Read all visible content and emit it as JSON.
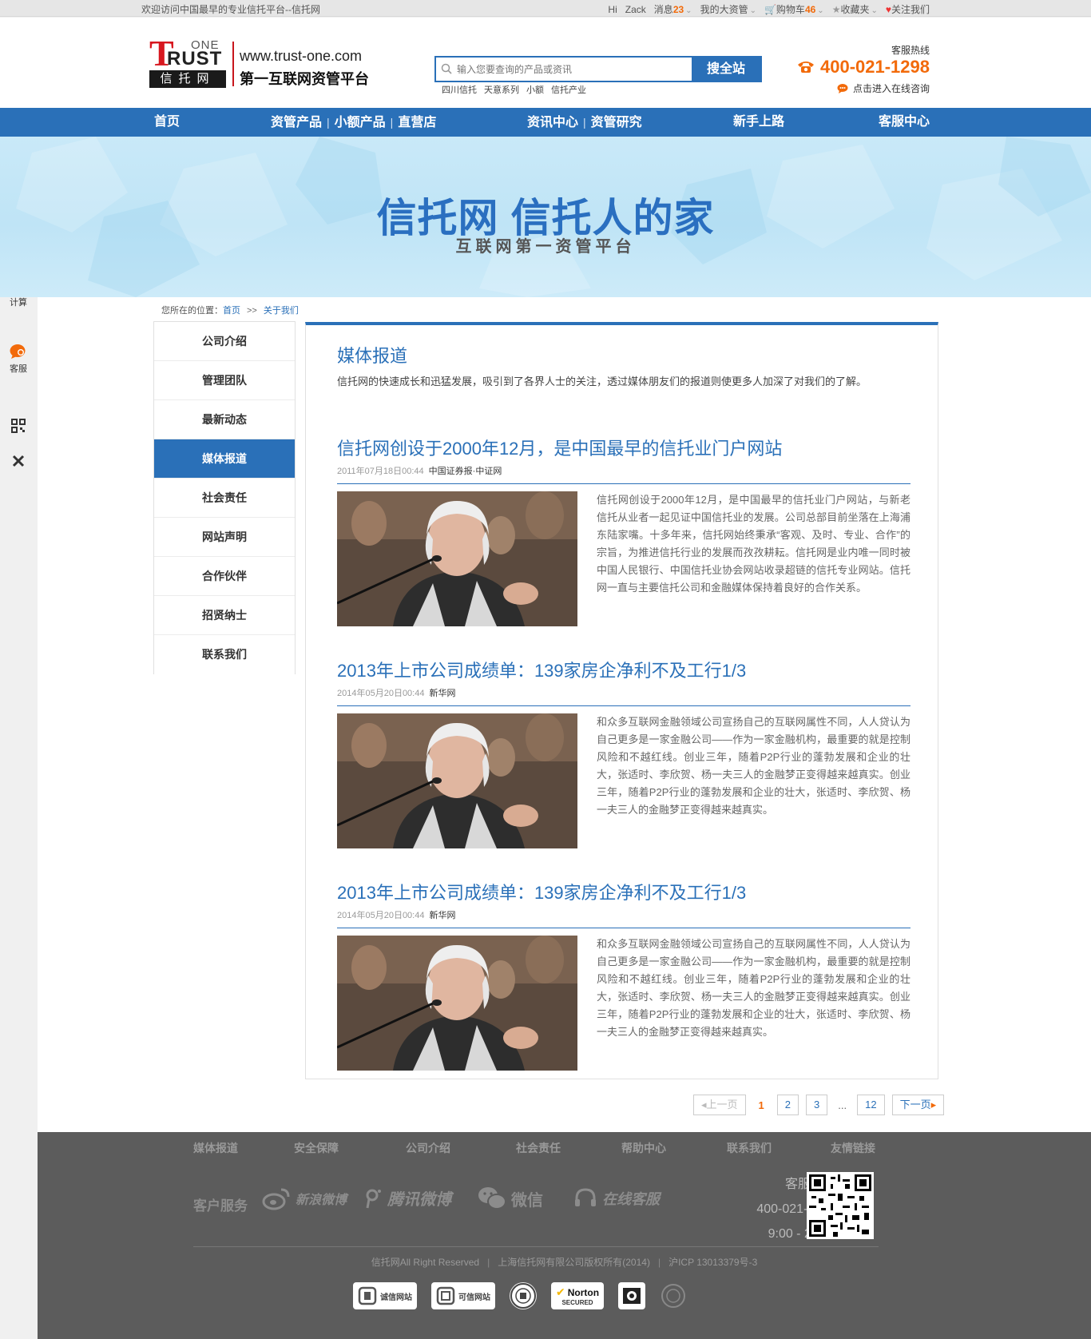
{
  "topbar": {
    "welcome": "欢迎访问中国最早的专业信托平台--信托网",
    "hi": "Hi",
    "user": "Zack",
    "messages_label": "消息",
    "messages_count": "23",
    "my_assets": "我的大资管",
    "cart_label": "购物车",
    "cart_count": "46",
    "favorites": "收藏夹",
    "follow": "关注我们"
  },
  "header": {
    "logo_one": "ONE",
    "logo_rust": "RUST",
    "logo_t": "T",
    "logo_cn": "信托网",
    "site_url": "www.trust-one.com",
    "slogan": "第一互联网资管平台",
    "search_placeholder": "输入您要查询的产品或资讯",
    "search_button": "搜全站",
    "hot_keywords": [
      "四川信托",
      "天意系列",
      "小额",
      "信托产业"
    ],
    "hotline_label": "客服热线",
    "hotline": "400-021-1298",
    "consult": "点击进入在线咨询"
  },
  "nav": {
    "home": "首页",
    "products": "资管产品",
    "small": "小额产品",
    "store": "直营店",
    "news": "资讯中心",
    "research": "资管研究",
    "newbie": "新手上路",
    "service": "客服中心",
    "sep": "|"
  },
  "banner": {
    "title": "信托网 信托人的家",
    "subtitle": "互联网第一资管平台"
  },
  "side_tools": {
    "calc": "计算",
    "service": "客服"
  },
  "breadcrumb": {
    "prefix": "您所在的位置：",
    "home": "首页",
    "sep": ">>",
    "current": "关于我们"
  },
  "menu": [
    {
      "label": "公司介绍",
      "active": false
    },
    {
      "label": "管理团队",
      "active": false
    },
    {
      "label": "最新动态",
      "active": false
    },
    {
      "label": "媒体报道",
      "active": true
    },
    {
      "label": "社会责任",
      "active": false
    },
    {
      "label": "网站声明",
      "active": false
    },
    {
      "label": "合作伙伴",
      "active": false
    },
    {
      "label": "招贤纳士",
      "active": false
    },
    {
      "label": "联系我们",
      "active": false
    }
  ],
  "content": {
    "heading": "媒体报道",
    "intro": "信托网的快速成长和迅猛发展，吸引到了各界人士的关注，透过媒体朋友们的报道则使更多人加深了对我们的了解。",
    "articles": [
      {
        "title": "信托网创设于2000年12月，是中国最早的信托业门户网站",
        "date": "2011年07月18日00:44",
        "source": "中国证券报·中证网",
        "text": "信托网创设于2000年12月，是中国最早的信托业门户网站，与新老信托从业者一起见证中国信托业的发展。公司总部目前坐落在上海浦东陆家嘴。十多年来，信托网始终秉承“客观、及时、专业、合作”的宗旨，为推进信托行业的发展而孜孜耕耘。信托网是业内唯一同时被中国人民银行、中国信托业协会网站收录超链的信托专业网站。信托网一直与主要信托公司和金融媒体保持着良好的合作关系。"
      },
      {
        "title": "2013年上市公司成绩单：139家房企净利不及工行1/3",
        "date": "2014年05月20日00:44",
        "source": "新华网",
        "text": "和众多互联网金融领域公司宣扬自己的互联网属性不同，人人贷认为自己更多是一家金融公司——作为一家金融机构，最重要的就是控制风险和不越红线。创业三年，随着P2P行业的蓬勃发展和企业的壮大，张适时、李欣贺、杨一夫三人的金融梦正变得越来越真实。创业三年，随着P2P行业的蓬勃发展和企业的壮大，张适时、李欣贺、杨一夫三人的金融梦正变得越来越真实。"
      },
      {
        "title": "2013年上市公司成绩单：139家房企净利不及工行1/3",
        "date": "2014年05月20日00:44",
        "source": "新华网",
        "text": "和众多互联网金融领域公司宣扬自己的互联网属性不同，人人贷认为自己更多是一家金融公司——作为一家金融机构，最重要的就是控制风险和不越红线。创业三年，随着P2P行业的蓬勃发展和企业的壮大，张适时、李欣贺、杨一夫三人的金融梦正变得越来越真实。创业三年，随着P2P行业的蓬勃发展和企业的壮大，张适时、李欣贺、杨一夫三人的金融梦正变得越来越真实。"
      }
    ]
  },
  "pager": {
    "prev": "上一页",
    "current": "1",
    "p2": "2",
    "p3": "3",
    "dots": "...",
    "last": "12",
    "next": "下一页"
  },
  "footer": {
    "links": [
      "媒体报道",
      "安全保障",
      "公司介绍",
      "社会责任",
      "帮助中心",
      "联系我们",
      "友情链接"
    ],
    "service_label": "客户服务",
    "weibo": "新浪微博",
    "tencent": "腾讯微博",
    "wechat": "微信",
    "online": "在线客服",
    "phone_label": "客服电话",
    "phone": "400-021-1298",
    "hours": "9:00 - 21:00",
    "copyright": "信托网All Right Reserved",
    "company": "上海信托网有限公司版权所有(2014)",
    "icp": "沪ICP 13013379号-3",
    "badge_chengxin": "诚信网站",
    "badge_kexin": "可信网站",
    "badge_norton_1": "Norton",
    "badge_norton_2": "SECURED"
  },
  "colors": {
    "brand_blue": "#2a70b8",
    "accent_orange": "#f26a0a",
    "logo_red": "#d7171f",
    "footer_bg": "#5c5c5c"
  }
}
